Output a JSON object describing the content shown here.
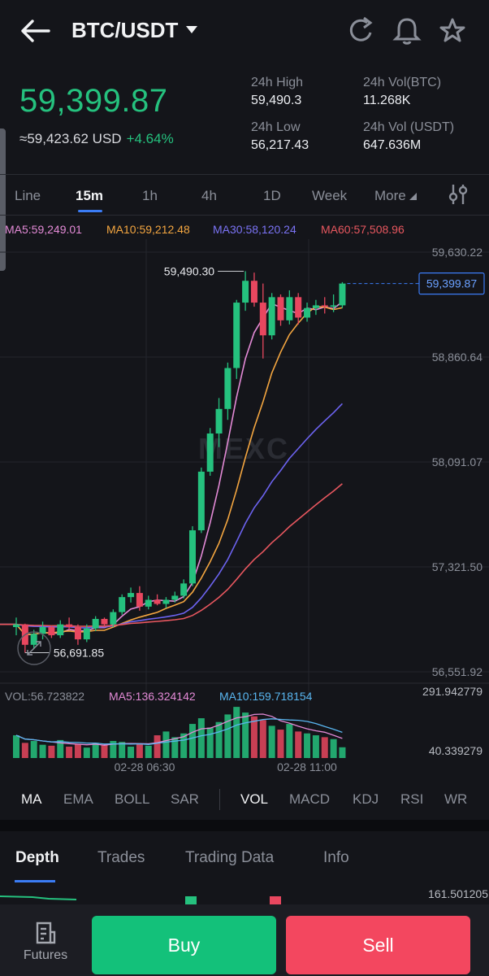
{
  "header": {
    "pair": "BTC/USDT",
    "icons": [
      "back-arrow-icon",
      "caret-down-icon",
      "refresh-icon",
      "bell-icon",
      "star-icon"
    ]
  },
  "ticker": {
    "last_price": "59,399.87",
    "usd_value": "≈59,423.62 USD",
    "change_pct": "+4.64%",
    "high_label": "24h High",
    "high_value": "59,490.3",
    "low_label": "24h Low",
    "low_value": "56,217.43",
    "vol_btc_label": "24h Vol(BTC)",
    "vol_btc_value": "11.268K",
    "vol_usdt_label": "24h Vol (USDT)",
    "vol_usdt_value": "647.636M"
  },
  "timeframes": {
    "items": [
      "Line",
      "15m",
      "1h",
      "4h",
      "1D",
      "Week",
      "More"
    ],
    "active": "15m",
    "settings_icon": "indicator-settings-icon"
  },
  "ma_legend": {
    "ma5": "MA5:59,249.01",
    "ma10": "MA10:59,212.48",
    "ma30": "MA30:58,120.24",
    "ma60": "MA60:57,508.96"
  },
  "chart": {
    "y_ticks": [
      "59,630.22",
      "58,860.64",
      "58,091.07",
      "57,321.50",
      "56,551.92"
    ],
    "high_marker": "59,490.30",
    "low_marker": "56,691.85",
    "current_price_tag": "59,399.87",
    "watermark": "MEXC",
    "vol_label": "VOL:56.723822",
    "vol_ma5": "MA5:136.324142",
    "vol_ma10": "MA10:159.718154",
    "vol_top": "291.942779",
    "vol_bottom": "40.339279",
    "x_ticks": [
      "02-28 06:30",
      "02-28 11:00"
    ],
    "colors": {
      "up": "#25c17e",
      "down": "#e8475f",
      "ma5": "#e38ad6",
      "ma10": "#f4a640",
      "ma30": "#6c63f0",
      "ma60": "#e8575f"
    }
  },
  "chart_data": {
    "type": "candlestick",
    "interval": "15m",
    "ylim": [
      56551.92,
      59630.22
    ],
    "candles": [
      [
        56880,
        56950,
        56820,
        56900
      ],
      [
        56900,
        56905,
        56691.85,
        56750
      ],
      [
        56750,
        56860,
        56720,
        56830
      ],
      [
        56830,
        56920,
        56790,
        56880
      ],
      [
        56880,
        56890,
        56800,
        56820
      ],
      [
        56820,
        56930,
        56800,
        56900
      ],
      [
        56900,
        56950,
        56860,
        56880
      ],
      [
        56880,
        56900,
        56750,
        56790
      ],
      [
        56790,
        56900,
        56770,
        56870
      ],
      [
        56870,
        56960,
        56850,
        56940
      ],
      [
        56940,
        56950,
        56880,
        56900
      ],
      [
        56900,
        57010,
        56880,
        56990
      ],
      [
        56990,
        57120,
        56970,
        57100
      ],
      [
        57100,
        57170,
        57060,
        57130
      ],
      [
        57130,
        57180,
        57000,
        57030
      ],
      [
        57030,
        57110,
        57010,
        57080
      ],
      [
        57080,
        57120,
        57040,
        57050
      ],
      [
        57050,
        57100,
        57020,
        57080
      ],
      [
        57080,
        57140,
        57060,
        57110
      ],
      [
        57110,
        57230,
        57090,
        57200
      ],
      [
        57200,
        57620,
        57180,
        57590
      ],
      [
        57590,
        58050,
        57570,
        58020
      ],
      [
        58020,
        58340,
        57990,
        58300
      ],
      [
        58300,
        58560,
        58200,
        58480
      ],
      [
        58480,
        58820,
        58400,
        58780
      ],
      [
        58780,
        59280,
        58700,
        59260
      ],
      [
        59260,
        59490.3,
        59200,
        59420
      ],
      [
        59420,
        59480,
        59230,
        59260
      ],
      [
        59260,
        59400,
        58850,
        59020
      ],
      [
        59020,
        59330,
        58990,
        59300
      ],
      [
        59300,
        59320,
        59090,
        59130
      ],
      [
        59130,
        59350,
        59100,
        59300
      ],
      [
        59300,
        59330,
        59100,
        59150
      ],
      [
        59150,
        59260,
        59120,
        59220
      ],
      [
        59220,
        59280,
        59170,
        59240
      ],
      [
        59240,
        59300,
        59180,
        59230
      ],
      [
        59230,
        59320,
        59190,
        59240
      ],
      [
        59240,
        59410,
        59220,
        59399.87
      ]
    ],
    "volumes": [
      120,
      80,
      90,
      70,
      65,
      95,
      60,
      75,
      55,
      80,
      70,
      90,
      85,
      60,
      75,
      65,
      120,
      140,
      110,
      130,
      180,
      210,
      160,
      190,
      230,
      270,
      240,
      220,
      200,
      170,
      150,
      180,
      140,
      130,
      120,
      110,
      100,
      56.72
    ]
  },
  "indicators": {
    "main": [
      "MA",
      "EMA",
      "BOLL",
      "SAR"
    ],
    "sub": [
      "VOL",
      "MACD",
      "KDJ",
      "RSI",
      "WR"
    ],
    "active_main": "MA",
    "active_sub": "VOL"
  },
  "depth_tabs": {
    "items": [
      "Depth",
      "Trades",
      "Trading Data",
      "Info"
    ],
    "active": "Depth",
    "depth_value": "161.501205"
  },
  "bottom": {
    "futures": "Futures",
    "buy": "Buy",
    "sell": "Sell"
  }
}
